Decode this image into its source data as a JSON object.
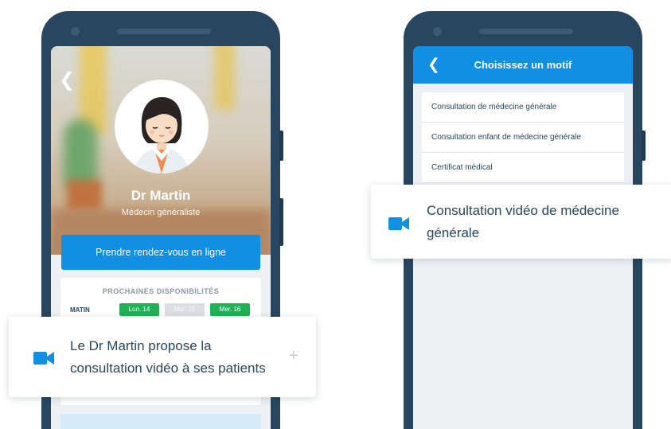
{
  "left_phone": {
    "back_icon": "chevron-left-icon",
    "doctor": {
      "name": "Dr Martin",
      "title": "Médecin généraliste"
    },
    "book_button": "Prendre rendez-vous en ligne",
    "availability": {
      "title": "PROCHAINES DISPONIBILITÉS",
      "slot_label": "MATIN",
      "days": [
        {
          "label": "Lun. 14",
          "available": true
        },
        {
          "label": "Mar. 15",
          "available": false
        },
        {
          "label": "Mer. 16",
          "available": true
        }
      ]
    }
  },
  "right_phone": {
    "back_icon": "chevron-left-icon",
    "header_title": "Choisissez un motif",
    "motifs": [
      "Consultation de médecine générale",
      "Consultation enfant de médecine générale",
      "Certificat médical"
    ]
  },
  "callouts": {
    "left": {
      "icon": "video-camera-icon",
      "line1": "Le Dr Martin propose la",
      "line2": "consultation vidéo à ses patients",
      "action_icon": "plus-icon"
    },
    "right": {
      "icon": "video-camera-icon",
      "line1": "Consultation vidéo de médecine",
      "line2": "générale"
    }
  },
  "colors": {
    "brand_blue": "#1190e3",
    "navy": "#284660",
    "available_green": "#1eb354",
    "phone_frame": "#284660"
  }
}
